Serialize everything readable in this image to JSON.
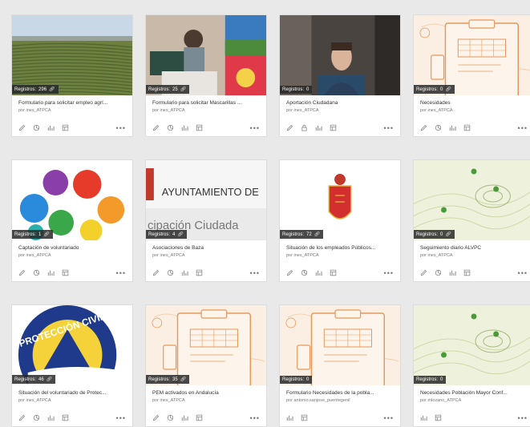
{
  "badge_prefix": "Registros:",
  "cards": [
    {
      "count": "296",
      "title": "Formulario para solicitar empleo agrí...",
      "owner": "por ines_ATPCA",
      "thumb": "field",
      "link": true,
      "actions": [
        "edit",
        "chart-pie",
        "bar-chart",
        "data-table"
      ]
    },
    {
      "count": "25",
      "title": "Formulario para solicitar Mascarillas ...",
      "owner": "por ines_ATPCA",
      "thumb": "sewing",
      "link": true,
      "actions": [
        "edit",
        "chart-pie",
        "bar-chart",
        "data-table"
      ]
    },
    {
      "count": "0",
      "title": "Aportación Ciudadana",
      "owner": "por ines_ATPCA",
      "thumb": "person",
      "link": false,
      "actions": [
        "edit",
        "lock",
        "bar-chart",
        "data-table"
      ]
    },
    {
      "count": "0",
      "title": "Necesidades",
      "owner": "por ines_ATPCA",
      "thumb": "clipboard",
      "link": true,
      "actions": [
        "edit",
        "chart-pie",
        "bar-chart",
        "data-table"
      ]
    },
    {
      "count": "1",
      "title": "Captación de voluntariado",
      "owner": "por ines_ATPCA",
      "thumb": "hands",
      "link": true,
      "actions": [
        "edit",
        "chart-pie",
        "bar-chart",
        "data-table"
      ]
    },
    {
      "count": "4",
      "title": "Asociaciones de Baza",
      "owner": "por ines_ATPCA",
      "thumb": "ayuntamiento",
      "link": true,
      "thumb_text1": "AYUNTAMIENTO DE",
      "thumb_text2": "cipación Ciudada",
      "actions": [
        "edit",
        "chart-pie",
        "bar-chart",
        "data-table"
      ]
    },
    {
      "count": "72",
      "title": "Situación de los empleados Públicos...",
      "owner": "por ines_ATPCA",
      "thumb": "shield",
      "link": true,
      "actions": [
        "edit",
        "chart-pie",
        "bar-chart",
        "data-table"
      ]
    },
    {
      "count": "0",
      "title": "Seguimiento diario ALVPC",
      "owner": "por ines_ATPCA",
      "thumb": "map",
      "link": true,
      "actions": [
        "edit",
        "chart-pie",
        "bar-chart",
        "data-table"
      ]
    },
    {
      "count": "46",
      "title": "Situación del voluntariado de Protec...",
      "owner": "por ines_ATPCA",
      "thumb": "proteccion",
      "link": true,
      "thumb_text1": "PROTECCIÓN CIVIL",
      "actions": [
        "edit",
        "chart-pie",
        "bar-chart",
        "data-table"
      ]
    },
    {
      "count": "35",
      "title": "PEM activados en Andalucía",
      "owner": "por ines_ATPCA",
      "thumb": "clipboard",
      "link": true,
      "actions": [
        "edit",
        "chart-pie",
        "bar-chart",
        "data-table"
      ]
    },
    {
      "count": "0",
      "title": "Formulario Necesidades de la pobla...",
      "owner": "por antonio.sanjose_puentegenil",
      "thumb": "clipboard",
      "link": false,
      "actions": [
        "bar-chart",
        "data-table"
      ]
    },
    {
      "count": "0",
      "title": "Necesidades Población Mayor Conf...",
      "owner": "por mlozano_ATPCA",
      "thumb": "map",
      "link": false,
      "actions": [
        "bar-chart",
        "data-table"
      ]
    }
  ],
  "more_label": "•••"
}
